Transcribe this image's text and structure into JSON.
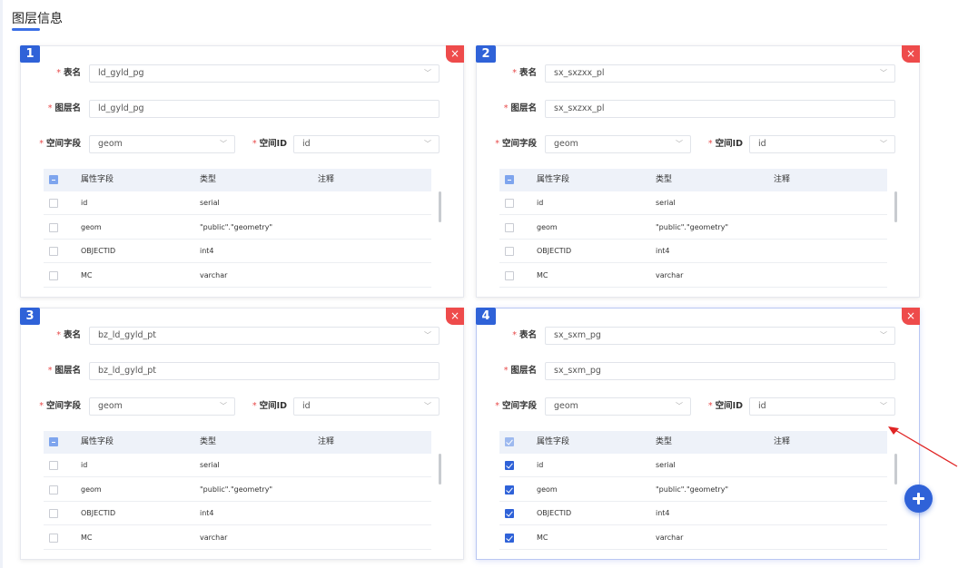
{
  "page": {
    "title": "图层信息"
  },
  "labels": {
    "table_name": "表名",
    "layer_name": "图层名",
    "spatial_field": "空间字段",
    "spatial_id": "空间ID",
    "required_mark": "*"
  },
  "columns": [
    "属性字段",
    "类型",
    "注释"
  ],
  "icons": {
    "close": "close-icon",
    "chevron": "chevron-down-icon",
    "add": "plus-icon",
    "arrow": "annotation-arrow"
  },
  "colors": {
    "accent": "#2f62d8",
    "close": "#ee4b4b",
    "required": "#e84a4a"
  },
  "panels": [
    {
      "number": "1",
      "close_glyph": "×",
      "table_name": "ld_gyld_pg",
      "layer_name": "ld_gyld_pg",
      "spatial_field": "geom",
      "spatial_id": "id",
      "header_check": "indeterminate",
      "rows": [
        {
          "field": "id",
          "type": "serial",
          "comment": "",
          "checked": false
        },
        {
          "field": "geom",
          "type": "\"public\".\"geometry\"",
          "comment": "",
          "checked": false
        },
        {
          "field": "OBJECTID",
          "type": "int4",
          "comment": "",
          "checked": false
        },
        {
          "field": "MC",
          "type": "varchar",
          "comment": "",
          "checked": false
        }
      ]
    },
    {
      "number": "2",
      "close_glyph": "×",
      "table_name": "sx_sxzxx_pl",
      "layer_name": "sx_sxzxx_pl",
      "spatial_field": "geom",
      "spatial_id": "id",
      "header_check": "indeterminate",
      "rows": [
        {
          "field": "id",
          "type": "serial",
          "comment": "",
          "checked": false
        },
        {
          "field": "geom",
          "type": "\"public\".\"geometry\"",
          "comment": "",
          "checked": false
        },
        {
          "field": "OBJECTID",
          "type": "int4",
          "comment": "",
          "checked": false
        },
        {
          "field": "MC",
          "type": "varchar",
          "comment": "",
          "checked": false
        }
      ]
    },
    {
      "number": "3",
      "close_glyph": "×",
      "table_name": "bz_ld_gyld_pt",
      "layer_name": "bz_ld_gyld_pt",
      "spatial_field": "geom",
      "spatial_id": "id",
      "header_check": "indeterminate",
      "rows": [
        {
          "field": "id",
          "type": "serial",
          "comment": "",
          "checked": false
        },
        {
          "field": "geom",
          "type": "\"public\".\"geometry\"",
          "comment": "",
          "checked": false
        },
        {
          "field": "OBJECTID",
          "type": "int4",
          "comment": "",
          "checked": false
        },
        {
          "field": "MC",
          "type": "varchar",
          "comment": "",
          "checked": false
        }
      ]
    },
    {
      "number": "4",
      "close_glyph": "×",
      "table_name": "sx_sxm_pg",
      "layer_name": "sx_sxm_pg",
      "spatial_field": "geom",
      "spatial_id": "id",
      "header_check": "checked",
      "rows": [
        {
          "field": "id",
          "type": "serial",
          "comment": "",
          "checked": true
        },
        {
          "field": "geom",
          "type": "\"public\".\"geometry\"",
          "comment": "",
          "checked": true
        },
        {
          "field": "OBJECTID",
          "type": "int4",
          "comment": "",
          "checked": true
        },
        {
          "field": "MC",
          "type": "varchar",
          "comment": "",
          "checked": true
        }
      ]
    }
  ]
}
